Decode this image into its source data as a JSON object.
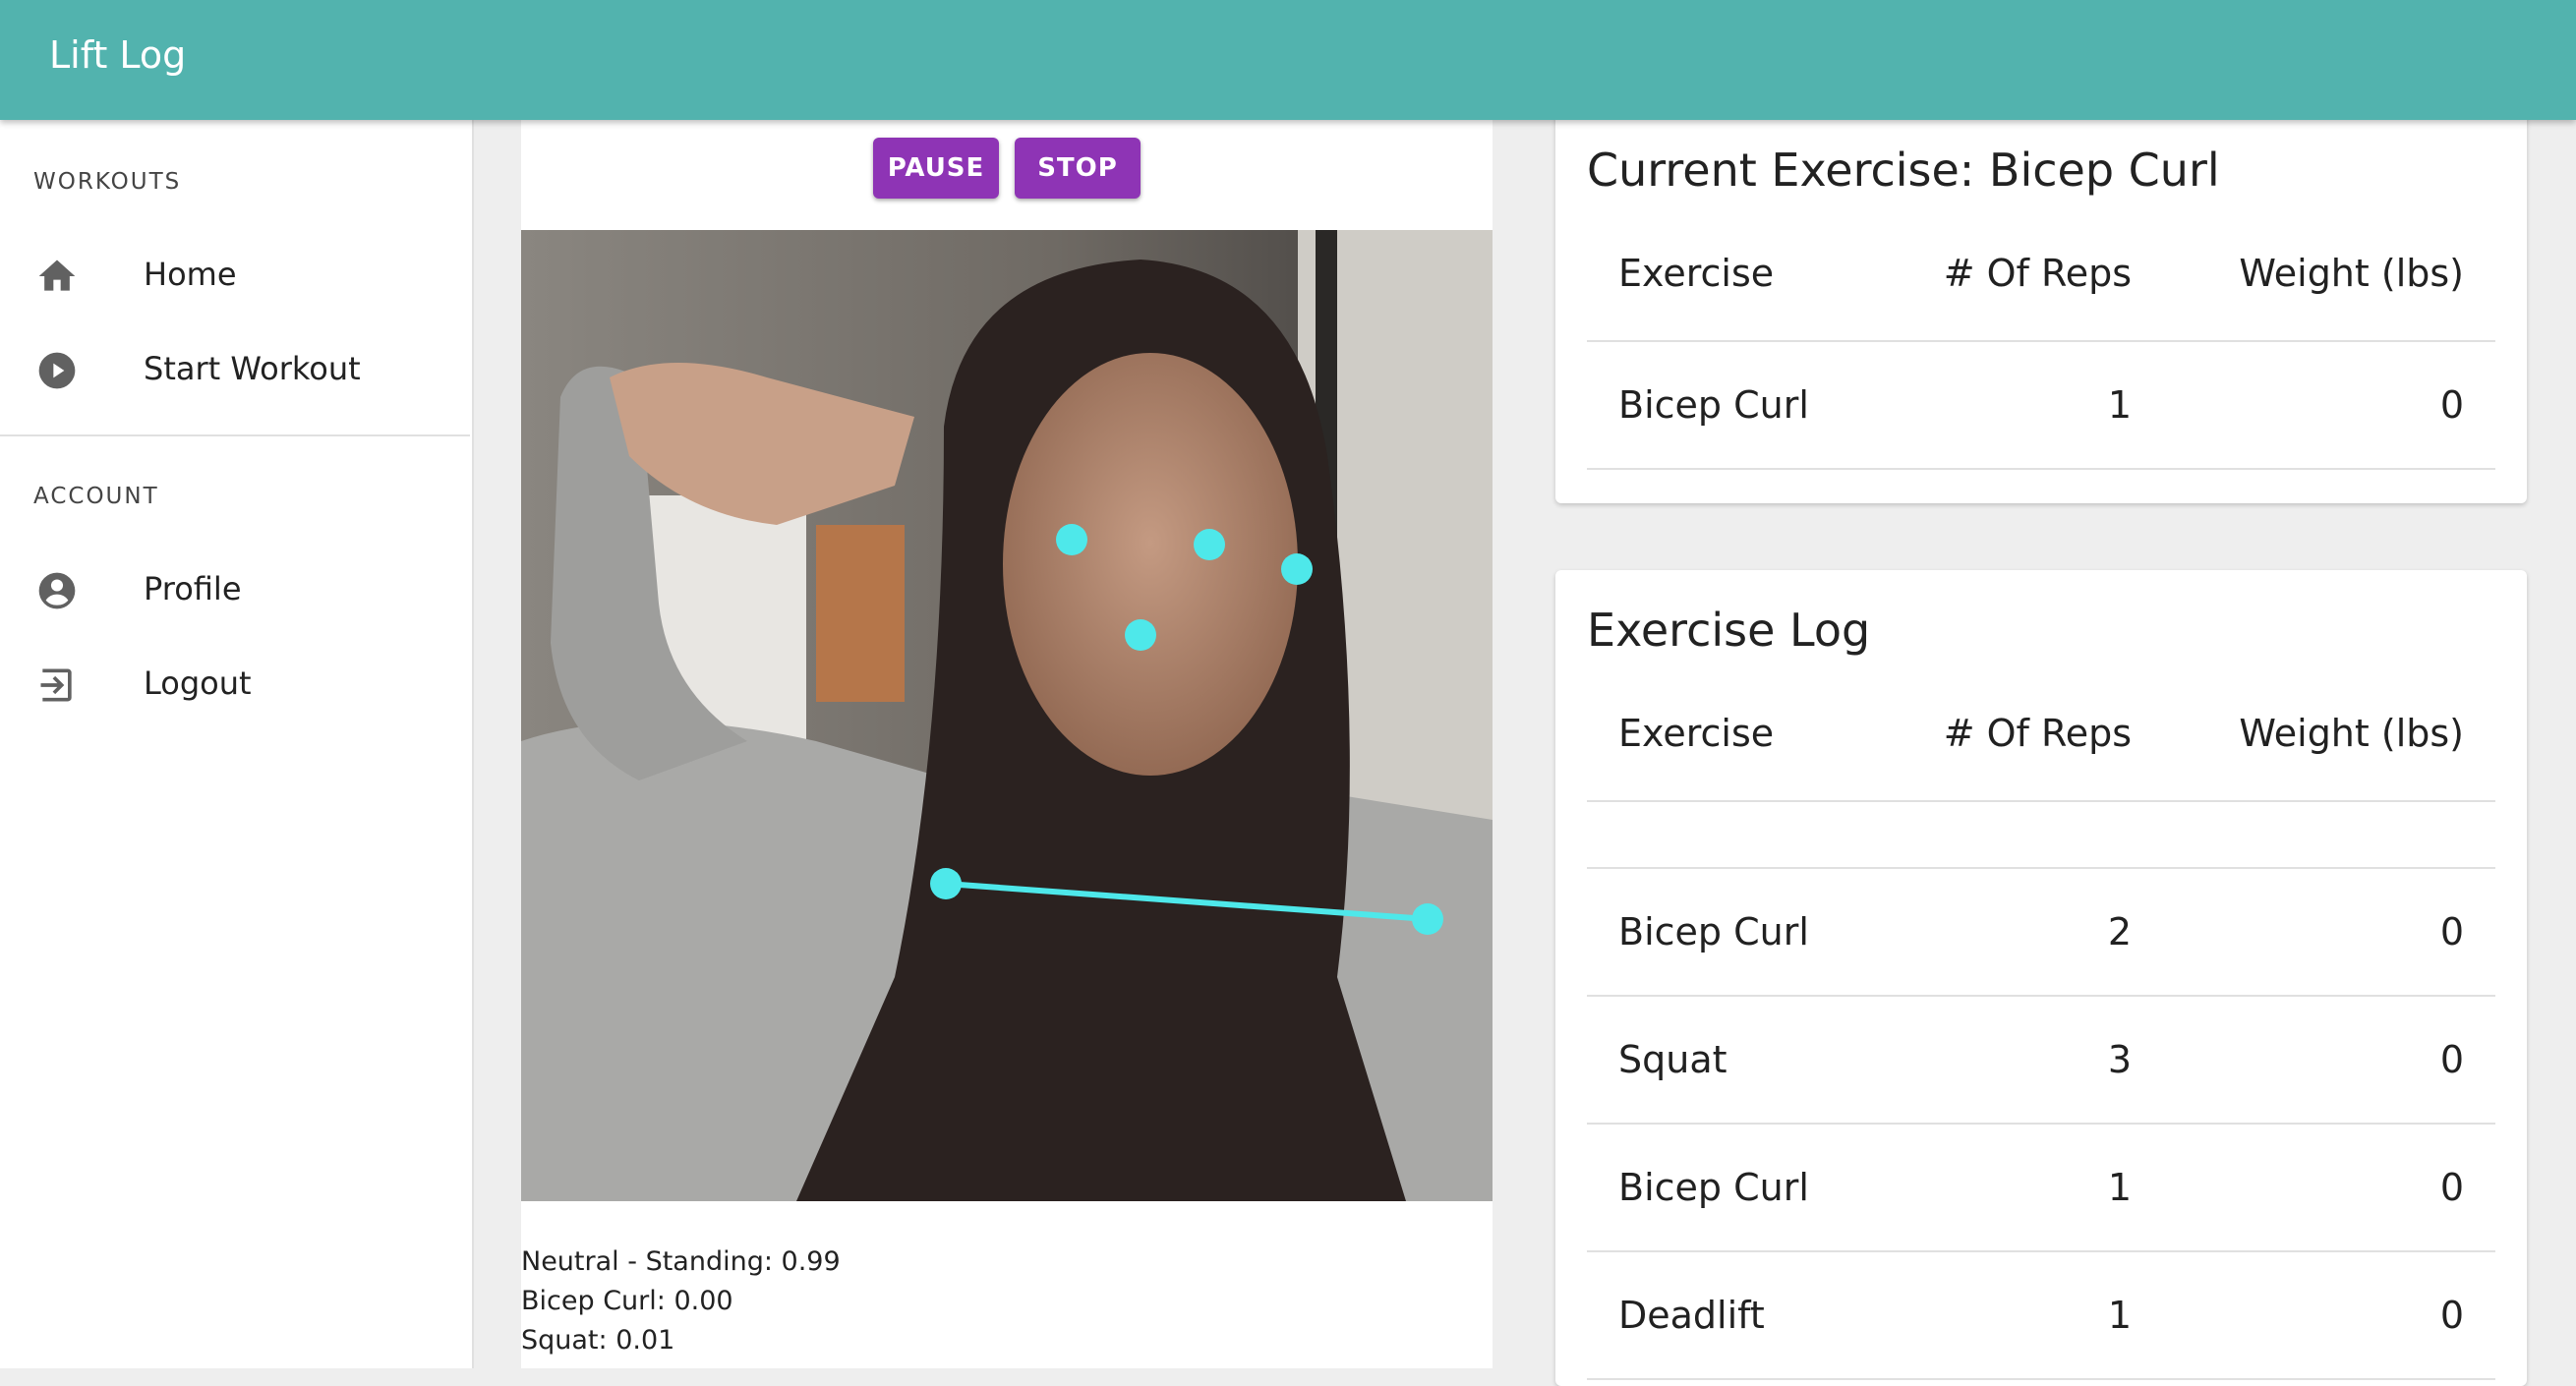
{
  "app": {
    "title": "Lift Log"
  },
  "sidebar": {
    "sections": [
      {
        "header": "WORKOUTS",
        "items": [
          {
            "label": "Home",
            "icon": "home-icon"
          },
          {
            "label": "Start Workout",
            "icon": "play-circle-icon"
          }
        ]
      },
      {
        "header": "ACCOUNT",
        "items": [
          {
            "label": "Profile",
            "icon": "account-circle-icon"
          },
          {
            "label": "Logout",
            "icon": "logout-icon"
          }
        ]
      }
    ]
  },
  "controls": {
    "pause_label": "PAUSE",
    "stop_label": "STOP",
    "color": "#8e34b5"
  },
  "predictions": [
    "Neutral - Standing: 0.99",
    "Bicep Curl: 0.00",
    "Squat: 0.01"
  ],
  "current_exercise": {
    "title": "Current Exercise: Bicep Curl",
    "columns": [
      "Exercise",
      "# Of Reps",
      "Weight (lbs)"
    ],
    "rows": [
      {
        "exercise": "Bicep Curl",
        "reps": "1",
        "weight": "0"
      }
    ]
  },
  "exercise_log": {
    "title": "Exercise Log",
    "columns": [
      "Exercise",
      "# Of Reps",
      "Weight (lbs)"
    ],
    "rows": [
      {
        "exercise": "Bicep Curl",
        "reps": "2",
        "weight": "0"
      },
      {
        "exercise": "Squat",
        "reps": "3",
        "weight": "0"
      },
      {
        "exercise": "Bicep Curl",
        "reps": "1",
        "weight": "0"
      },
      {
        "exercise": "Deadlift",
        "reps": "1",
        "weight": "0"
      }
    ]
  },
  "colors": {
    "appbar": "#52b3ae",
    "keypoint": "#4ee8ea"
  }
}
